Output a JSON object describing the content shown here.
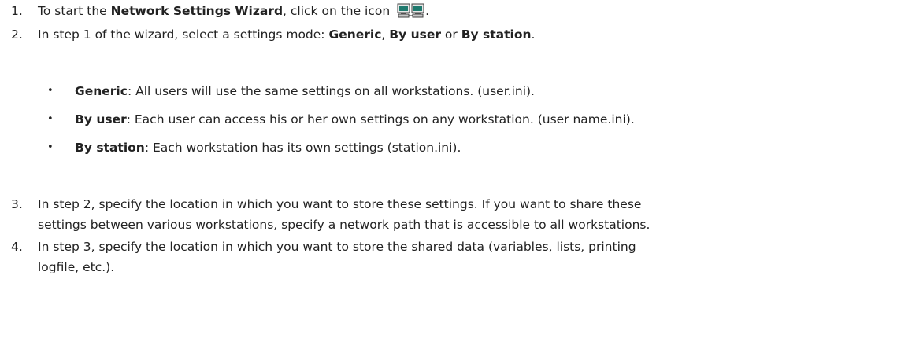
{
  "steps": [
    {
      "number": "1.",
      "before": "To start the ",
      "bold": "Network Settings Wizard",
      "after": ", click on the icon ",
      "end": ".",
      "icon": "network-settings-wizard-icon"
    },
    {
      "number": "2.",
      "before": "In step 1 of the wizard, select a settings mode: ",
      "mode1": "Generic",
      "sep1": ", ",
      "mode2": "By user",
      "sep2": " or ",
      "mode3": "By station",
      "end": "."
    },
    {
      "number": "3.",
      "line1": "In step 2, specify the location in which you want to store these settings. If you want to share these",
      "line2": "settings between various workstations, specify a network path that is accessible to all workstations."
    },
    {
      "number": "4.",
      "line1": "In step 3, specify the location in which you want to store the shared data (variables, lists, printing",
      "line2": "logfile, etc.)."
    }
  ],
  "modes": [
    {
      "bullet": "•",
      "name": "Generic",
      "desc": ": All users will use the same settings on all workstations. (user.ini)."
    },
    {
      "bullet": "•",
      "name": "By user",
      "desc": ": Each user can access his or her own settings on any workstation. (user name.ini)."
    },
    {
      "bullet": "•",
      "name": "By station",
      "desc": ": Each workstation has its own settings (station.ini)."
    }
  ],
  "colors": {
    "text": "#222222",
    "background": "#ffffff"
  }
}
